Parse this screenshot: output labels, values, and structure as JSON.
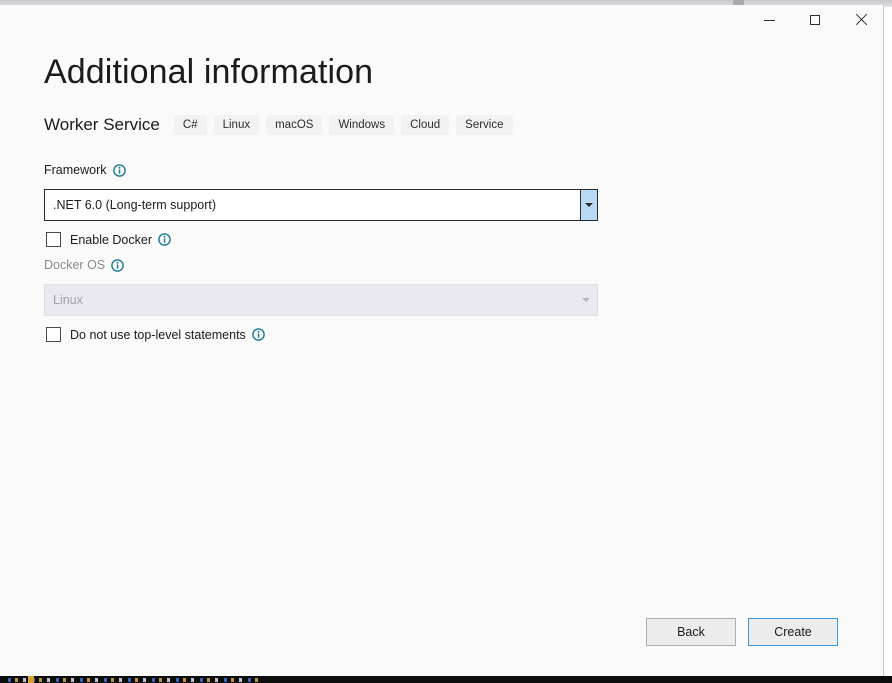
{
  "window": {
    "controls": {
      "minimize_label": "Minimize",
      "maximize_label": "Maximize",
      "close_label": "Close"
    }
  },
  "page": {
    "title": "Additional information",
    "template_name": "Worker Service",
    "tags": [
      "C#",
      "Linux",
      "macOS",
      "Windows",
      "Cloud",
      "Service"
    ]
  },
  "form": {
    "framework": {
      "label": "Framework",
      "value": ".NET 6.0 (Long-term support)",
      "info_tooltip": "Framework"
    },
    "enable_docker": {
      "label": "Enable Docker",
      "checked": false
    },
    "docker_os": {
      "label": "Docker OS",
      "value": "Linux",
      "disabled": true
    },
    "no_top_level_statements": {
      "label": "Do not use top-level statements",
      "checked": false
    }
  },
  "footer": {
    "back_label": "Back",
    "create_label": "Create"
  },
  "colors": {
    "accent": "#3a96dd",
    "info_icon": "#1d7a96",
    "combo_arrow_bg": "#b9d9f5",
    "tag_bg": "#f2f2f2",
    "dialog_bg": "#fafafa"
  }
}
